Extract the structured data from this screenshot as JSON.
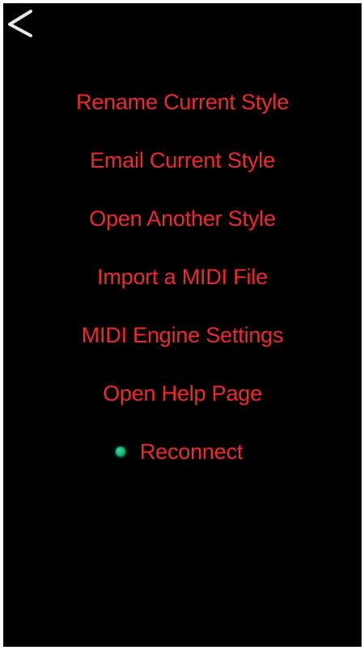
{
  "header": {
    "back_icon": "chevron-left-icon"
  },
  "menu": {
    "items": [
      {
        "label": "Rename Current Style"
      },
      {
        "label": "Email Current Style"
      },
      {
        "label": "Open Another Style"
      },
      {
        "label": "Import a MIDI File"
      },
      {
        "label": "MIDI Engine Settings"
      },
      {
        "label": "Open Help Page"
      }
    ],
    "reconnect": {
      "label": "Reconnect",
      "status_color": "#1ec88a"
    }
  },
  "colors": {
    "background": "#000000",
    "menu_text": "#ee2a2e",
    "back_icon": "#e8e8e8"
  }
}
